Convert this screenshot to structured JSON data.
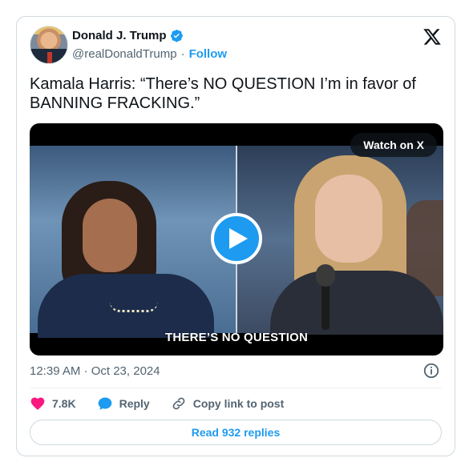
{
  "author": {
    "name": "Donald J. Trump",
    "handle": "@realDonaldTrump",
    "separator": "·",
    "follow_label": "Follow"
  },
  "tweet": {
    "text": "Kamala Harris: “There’s NO QUESTION I’m in favor of BANNING FRACKING.”"
  },
  "media": {
    "watch_label": "Watch on X",
    "caption": "THERE’S NO QUESTION"
  },
  "meta": {
    "timestamp": "12:39 AM · Oct 23, 2024"
  },
  "actions": {
    "like_count": "7.8K",
    "reply_label": "Reply",
    "copy_label": "Copy link to post"
  },
  "footer": {
    "read_replies_label": "Read 932 replies"
  },
  "colors": {
    "accent": "#1d9bf0",
    "like": "#f91880",
    "muted": "#536471"
  }
}
